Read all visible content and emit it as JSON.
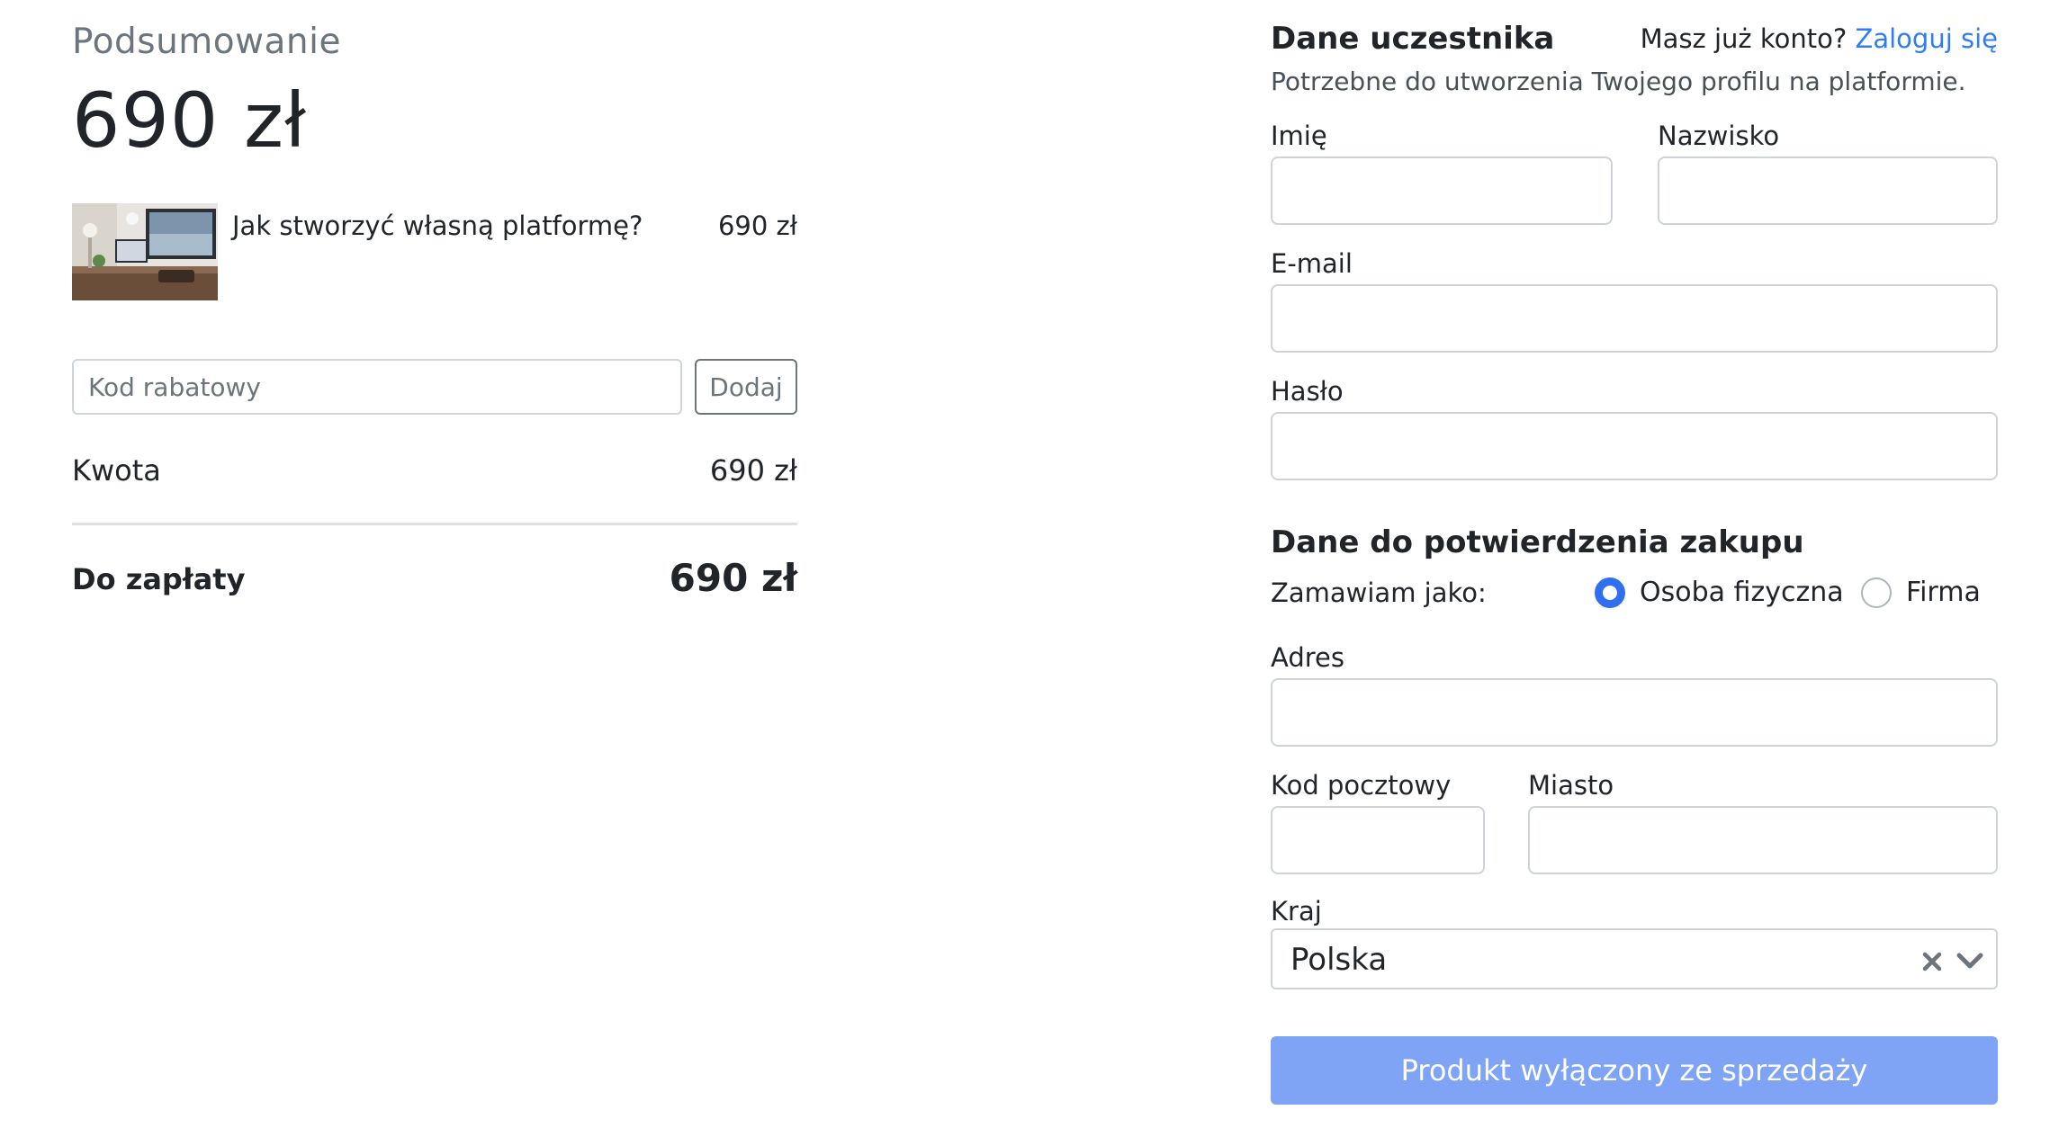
{
  "summary": {
    "title": "Podsumowanie",
    "total": "690 zł",
    "product": {
      "name": "Jak stworzyć własną platformę?",
      "price": "690 zł"
    },
    "coupon": {
      "placeholder": "Kod rabatowy",
      "button_label": "Dodaj"
    },
    "amount_label": "Kwota",
    "amount_value": "690 zł",
    "to_pay_label": "Do zapłaty",
    "to_pay_value": "690 zł"
  },
  "participant": {
    "title": "Dane uczestnika",
    "login_prompt": "Masz już konto?",
    "login_link": "Zaloguj się",
    "subtitle": "Potrzebne do utworzenia Twojego profilu na platformie.",
    "first_name_label": "Imię",
    "last_name_label": "Nazwisko",
    "email_label": "E-mail",
    "password_label": "Hasło"
  },
  "purchase": {
    "title": "Dane do potwierdzenia zakupu",
    "order_as_label": "Zamawiam jako:",
    "options": [
      "Osoba fizyczna",
      "Firma"
    ],
    "selected_option": "Osoba fizyczna",
    "address_label": "Adres",
    "postal_code_label": "Kod pocztowy",
    "city_label": "Miasto",
    "country_label": "Kraj",
    "country_value": "Polska",
    "submit_label": "Produkt wyłączony ze sprzedaży"
  },
  "colors": {
    "link": "#2f7df6",
    "radio_checked": "#2f6ff0",
    "submit_disabled": "#7fa3f5"
  },
  "icons": {
    "clear": "close-icon",
    "dropdown": "chevron-down-icon"
  }
}
